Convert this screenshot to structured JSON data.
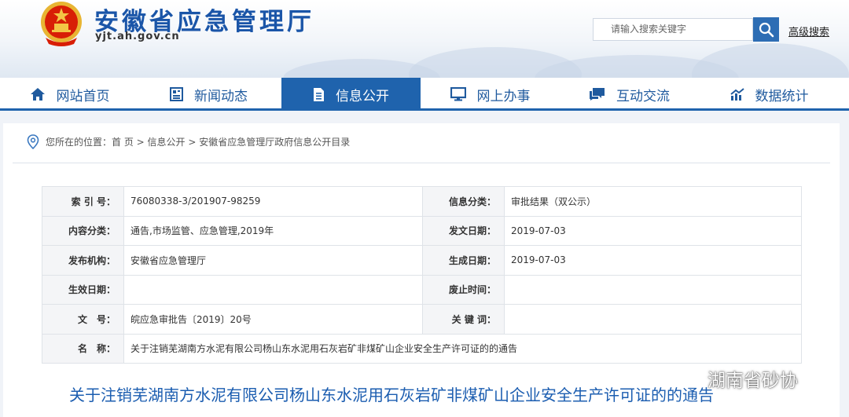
{
  "header": {
    "site_title": "安徽省应急管理厅",
    "site_domain": "yjt.ah.gov.cn",
    "search_placeholder": "请输入搜索关键字",
    "advanced_search": "高级搜索"
  },
  "nav": {
    "items": [
      {
        "label": "网站首页",
        "icon": "home-icon"
      },
      {
        "label": "新闻动态",
        "icon": "news-icon"
      },
      {
        "label": "信息公开",
        "icon": "document-icon",
        "active": true
      },
      {
        "label": "网上办事",
        "icon": "monitor-icon"
      },
      {
        "label": "互动交流",
        "icon": "chat-icon"
      },
      {
        "label": "数据统计",
        "icon": "chart-icon"
      }
    ]
  },
  "breadcrumb": {
    "prefix": "您所在的位置：",
    "path": "首 页 > 信息公开 > 安徽省应急管理厅政府信息公开目录"
  },
  "info_table": {
    "index_label": "索 引 号：",
    "index_value": "76080338-3/201907-98259",
    "category_label": "信息分类：",
    "category_value": "审批结果（双公示）",
    "content_label": "内容分类：",
    "content_value": "通告,市场监管、应急管理,2019年",
    "issue_date_label": "发文日期：",
    "issue_date_value": "2019-07-03",
    "publisher_label": "发布机构：",
    "publisher_value": "安徽省应急管理厅",
    "created_label": "生成日期：",
    "created_value": "2019-07-03",
    "effective_label": "生效日期：",
    "effective_value": "",
    "abolish_label": "废止时间：",
    "abolish_value": "",
    "docnum_label": "文　号：",
    "docnum_value": "皖应急审批告〔2019〕20号",
    "keywords_label": "关 键 词：",
    "keywords_value": "",
    "name_label": "名　称：",
    "name_value": "关于注销芜湖南方水泥有限公司杨山东水泥用石灰岩矿非煤矿山企业安全生产许可证的的通告"
  },
  "doc_title": "关于注销芜湖南方水泥有限公司杨山东水泥用石灰岩矿非煤矿山企业安全生产许可证的的通告",
  "watermark": "湖南省砂协",
  "colors": {
    "primary": "#1f63ad",
    "title_blue": "#1b5db0",
    "emblem_red": "#d81e06",
    "emblem_gold": "#f3c545"
  }
}
